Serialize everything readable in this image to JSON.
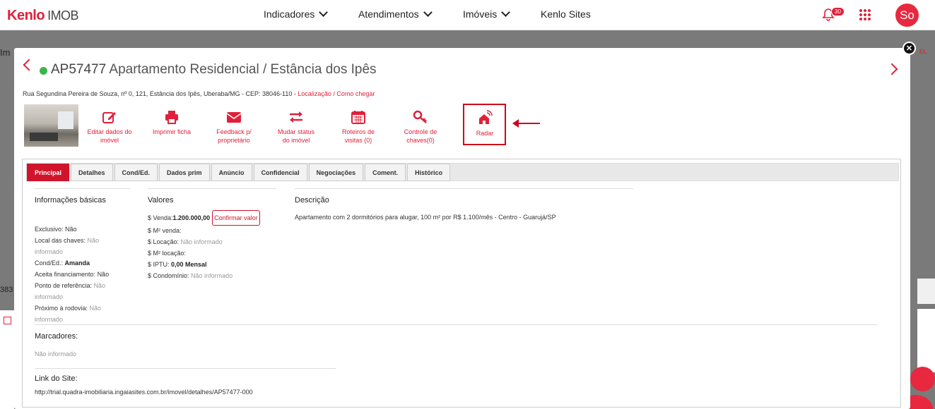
{
  "topbar": {
    "logo_main": "Kenlo",
    "logo_sub": "IMOB",
    "nav": [
      {
        "label": "Indicadores"
      },
      {
        "label": "Atendimentos"
      },
      {
        "label": "Imóveis"
      },
      {
        "label": "Kenlo Sites"
      }
    ],
    "notification_count": "30",
    "avatar_initials": "So"
  },
  "background": {
    "left_frag_1": "Im",
    "left_frag_2": "383",
    "right_frag": "EL"
  },
  "modal": {
    "code": "AP57477",
    "title": "Apartamento Residencial / Estância dos Ipês",
    "address": "Rua Segundina Pereira de Souza, nº 0, 121, Estância dos Ipês, Uberaba/MG - CEP: 38046-110 - ",
    "address_link1": "Localização",
    "address_sep": " / ",
    "address_link2": "Como chegar",
    "actions": [
      {
        "label1": "Editar dados do",
        "label2": "imóvel",
        "icon": "edit-icon"
      },
      {
        "label1": "Imprimir ficha",
        "label2": "",
        "icon": "printer-icon"
      },
      {
        "label1": "Feedback p/",
        "label2": "proprietário",
        "icon": "mail-icon"
      },
      {
        "label1": "Mudar status",
        "label2": "do imóvel",
        "icon": "exchange-icon"
      },
      {
        "label1": "Roteiros de",
        "label2": "visitas (0)",
        "icon": "calendar-icon"
      },
      {
        "label1": "Controle de",
        "label2": "chaves(0)",
        "icon": "key-icon"
      },
      {
        "label1": "Radar",
        "label2": "",
        "icon": "radar-home-icon"
      }
    ],
    "tabs": [
      "Principal",
      "Detalhes",
      "Cond/Ed.",
      "Dados prim",
      "Anúncio",
      "Confidencial",
      "Negociações",
      "Coment.",
      "Histórico"
    ],
    "info": {
      "title": "Informações básicas",
      "exclusivo_label": "Exclusivo: ",
      "exclusivo_value": "Não",
      "local_chaves_label": "Local das chaves: ",
      "local_chaves_value1": "Não",
      "local_chaves_value2": "informado",
      "cond_label": "Cond/Ed.: ",
      "cond_value": "Amanda",
      "financ_label": "Aceita financiamento: ",
      "financ_value": "Não",
      "ref_label": "Ponto de referência: ",
      "ref_value1": "Não",
      "ref_value2": "informado",
      "rodovia_label": "Próximo à rodovia: ",
      "rodovia_value1": "Não",
      "rodovia_value2": "informado"
    },
    "valores": {
      "title": "Valores",
      "venda_label": "$ Venda: ",
      "venda_value": "1.200.000,00",
      "confirm_button": "Confirmar valor",
      "m2_venda": "$ M² venda:",
      "locacao_label": "$ Locação: ",
      "locacao_value": "Não informado",
      "m2_locacao": "$ M² locação:",
      "iptu_label": "$ IPTU: ",
      "iptu_value": "0,00 Mensal",
      "cond_label": "$ Condomínio: ",
      "cond_value": "Não informado"
    },
    "descricao": {
      "title": "Descrição",
      "text": "Apartamento com 2 dormitórios para alugar, 100 m² por R$ 1.100/mês - Centro - Guarujá/SP"
    },
    "marcadores": {
      "title": "Marcadores:",
      "value": "Não informado"
    },
    "link_site": {
      "title": "Link do Site:",
      "value": "http://trial.quadra-imobiliaria.ingaiasites.com.br/imovel/detalhes/AP57477-000"
    }
  },
  "colors": {
    "accent": "#e0203a",
    "status_green": "#3bb54a",
    "highlight_red": "#d0021b"
  }
}
